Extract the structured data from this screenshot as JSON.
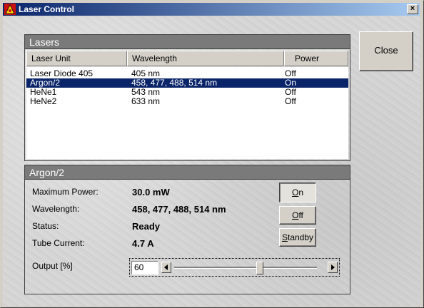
{
  "window": {
    "title": "Laser Control",
    "close_glyph": "×",
    "icon": "laser-app-icon"
  },
  "close_button": {
    "label": "Close"
  },
  "lasers_panel": {
    "title": "Lasers",
    "columns": [
      "Laser Unit",
      "Wavelength",
      "Power"
    ],
    "rows": [
      {
        "unit": "Laser Diode 405",
        "wavelength": "405 nm",
        "power": "Off",
        "selected": false
      },
      {
        "unit": "Argon/2",
        "wavelength": "458, 477, 488, 514 nm",
        "power": "On",
        "selected": true
      },
      {
        "unit": "HeNe1",
        "wavelength": "543 nm",
        "power": "Off",
        "selected": false
      },
      {
        "unit": "HeNe2",
        "wavelength": "633 nm",
        "power": "Off",
        "selected": false
      }
    ]
  },
  "detail_panel": {
    "title": "Argon/2",
    "max_power_label": "Maximum Power:",
    "max_power_value": "30.0 mW",
    "wavelength_label": "Wavelength:",
    "wavelength_value": "458, 477, 488, 514 nm",
    "status_label": "Status:",
    "status_value": "Ready",
    "tube_current_label": "Tube Current:",
    "tube_current_value": "4.7 A",
    "output_label": "Output [%]",
    "output_value": "60",
    "slider_fraction": 0.6
  },
  "buttons": {
    "on": {
      "accel": "O",
      "rest": "n",
      "pressed": true
    },
    "off": {
      "accel": "O",
      "rest": "ff"
    },
    "standby": {
      "accel": "S",
      "rest": "tandby"
    }
  },
  "colors": {
    "selection": "#0a246a",
    "panel_header": "#7a7a7a",
    "titlebar_start": "#0a246a",
    "titlebar_end": "#a6caf0"
  }
}
